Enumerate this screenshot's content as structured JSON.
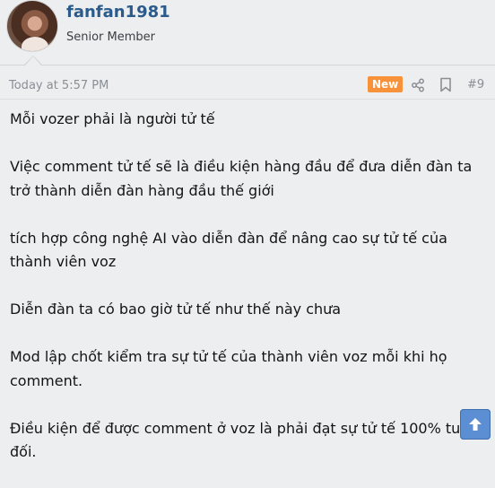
{
  "user": {
    "name": "fanfan1981",
    "title": "Senior Member"
  },
  "meta": {
    "date": "Today at 5:57 PM",
    "badge": "New",
    "post_number": "#9",
    "icons": [
      "share-icon",
      "bookmark-icon"
    ]
  },
  "body": {
    "paragraphs": [
      "Mỗi vozer phải là người tử tế",
      "Việc comment tử tế sẽ là điều kiện hàng đầu để đưa diễn đàn ta trở thành diễn đàn hàng đầu thế giới",
      "tích hợp công nghệ AI vào diễn đàn để nâng cao sự tử tế của thành viên voz",
      "Diễn đàn ta có bao giờ tử tế như thế này chưa",
      "Mod lập chốt kiểm tra sự tử tế của thành viên voz mỗi khi họ comment.",
      "Điều kiện để được comment ở voz là phải đạt sự tử tế 100% tuyệt đối."
    ]
  },
  "colors": {
    "background": "#eceef0",
    "username": "#2b5b8a",
    "badge": "#f7923a",
    "scroll_button": "#5b8ed3"
  }
}
